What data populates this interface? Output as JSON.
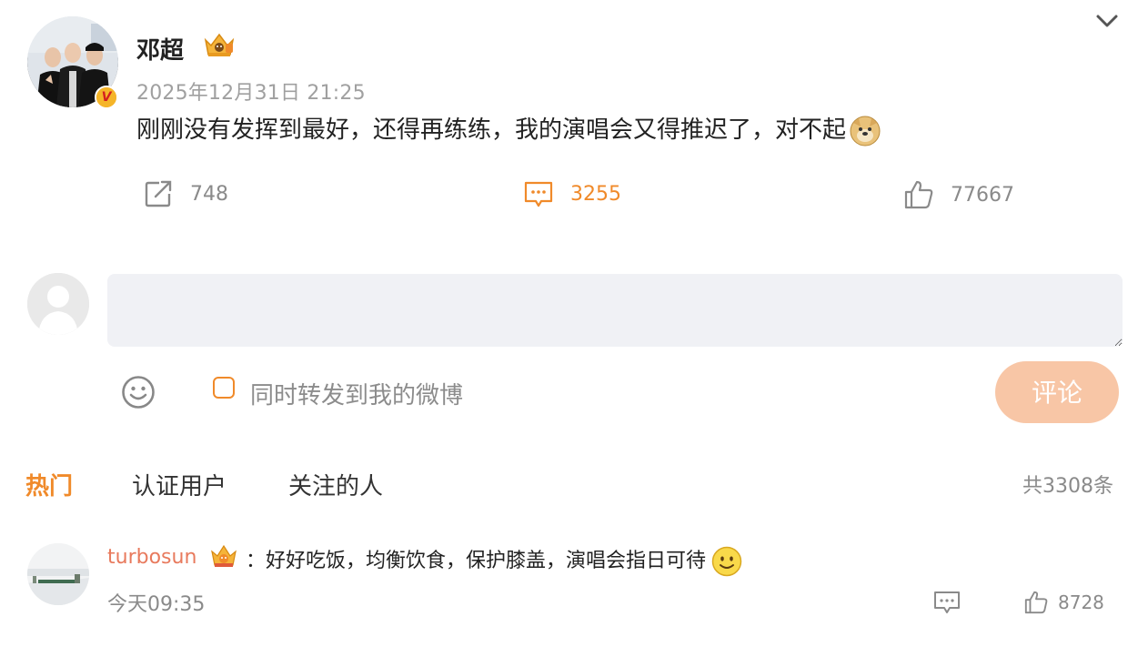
{
  "post": {
    "author": "邓超",
    "time": "2025年12月31日 21:25",
    "text": "刚刚没有发挥到最好，还得再练练，我的演唱会又得推迟了，对不起",
    "verified_badge": "V",
    "stats": {
      "reposts": "748",
      "comments": "3255",
      "likes": "77667"
    }
  },
  "composer": {
    "repost_label": "同时转发到我的微博",
    "submit_label": "评论",
    "placeholder": ""
  },
  "tabs": {
    "hot": "热门",
    "verified": "认证用户",
    "following": "关注的人",
    "total": "共3308条"
  },
  "comments": [
    {
      "user": "turbosun",
      "text": "：好好吃饭，均衡饮食，保护膝盖，演唱会指日可待",
      "time": "今天09:35",
      "likes": "8728"
    }
  ],
  "colors": {
    "accent": "#f08a2a",
    "submit_bg": "#f8c6a6",
    "username": "#e87a5d",
    "muted": "#8a8a8a"
  },
  "icons": [
    "chevron-down-icon",
    "crown-icon",
    "doge-icon",
    "repost-icon",
    "comment-icon",
    "like-icon",
    "smile-icon",
    "smiley-icon",
    "reply-icon"
  ]
}
